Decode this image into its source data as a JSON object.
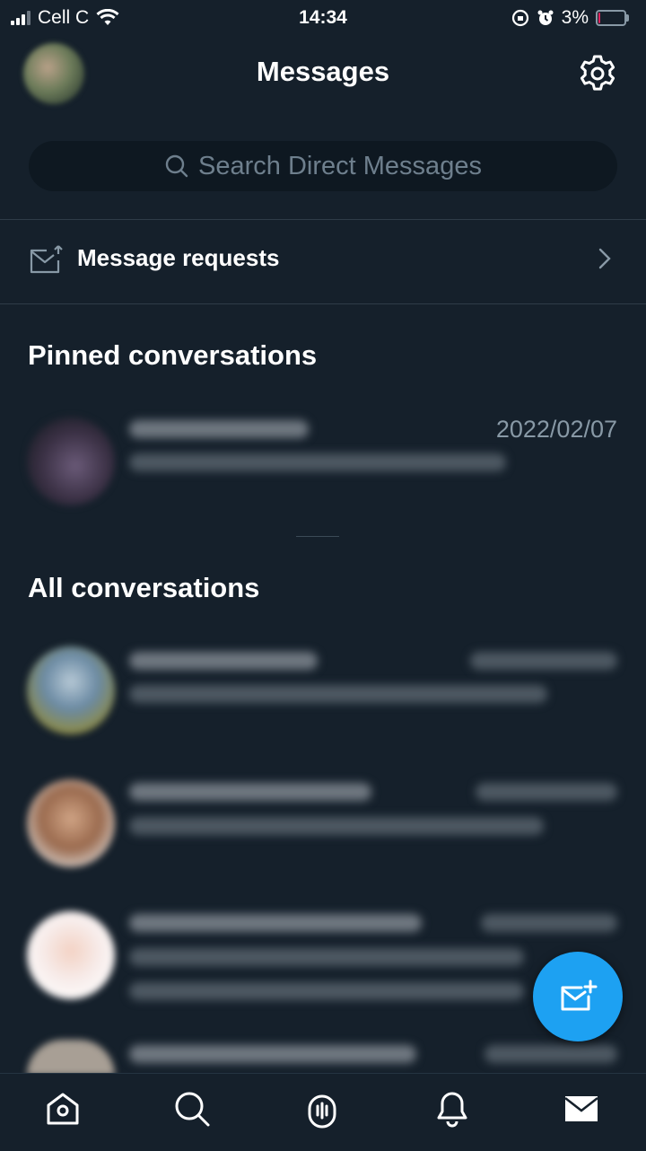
{
  "status_bar": {
    "carrier": "Cell C",
    "time": "14:34",
    "battery_percent": "3%",
    "battery_level": 0.03
  },
  "header": {
    "title": "Messages"
  },
  "search": {
    "placeholder": "Search Direct Messages"
  },
  "message_requests": {
    "label": "Message requests"
  },
  "pinned": {
    "heading": "Pinned conversations",
    "conversations": [
      {
        "date": "2022/02/07"
      }
    ]
  },
  "all": {
    "heading": "All conversations"
  },
  "tabs": [
    {
      "name": "home",
      "icon": "home-icon"
    },
    {
      "name": "search",
      "icon": "search-icon"
    },
    {
      "name": "spaces",
      "icon": "microphone-icon"
    },
    {
      "name": "notifications",
      "icon": "bell-icon"
    },
    {
      "name": "messages",
      "icon": "mail-icon"
    }
  ],
  "colors": {
    "background": "#15202b",
    "accent": "#1da1f2",
    "muted_text": "#8899a6",
    "battery_low": "#e0245e"
  }
}
